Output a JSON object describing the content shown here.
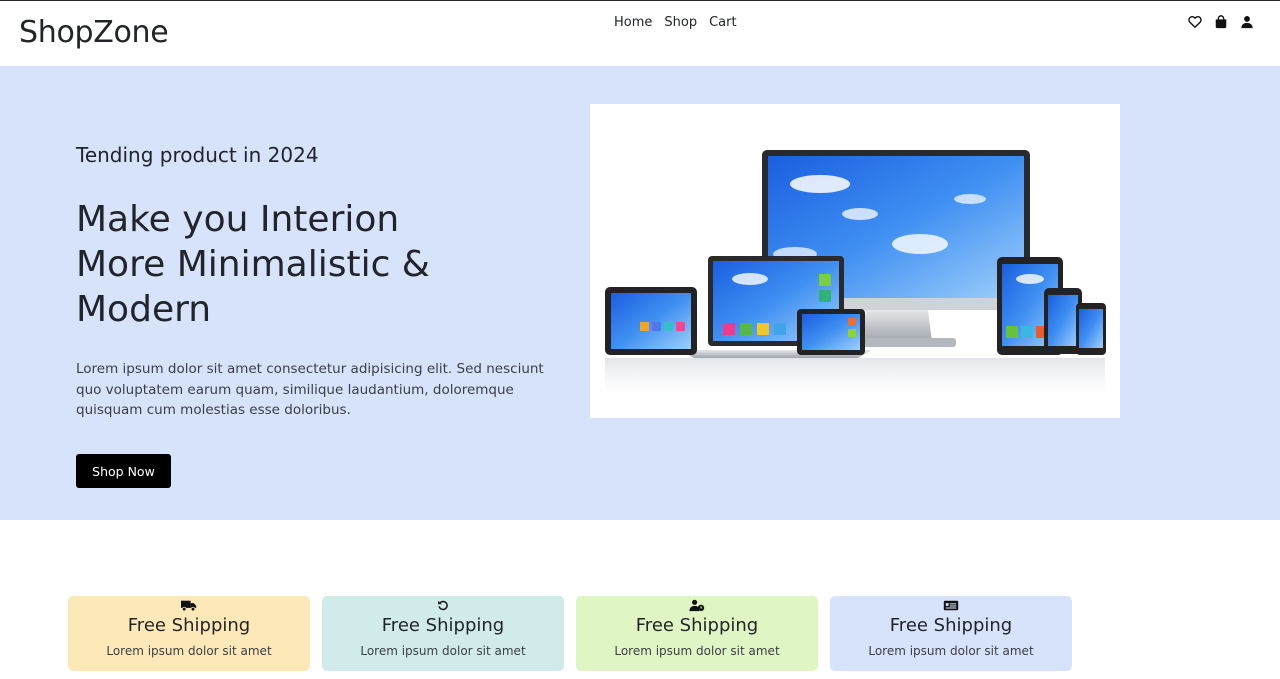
{
  "header": {
    "logo": "ShopZone",
    "nav": [
      {
        "label": "Home"
      },
      {
        "label": "Shop"
      },
      {
        "label": "Cart"
      }
    ],
    "icons": [
      "heart-icon",
      "shopping-bag-icon",
      "user-icon"
    ]
  },
  "hero": {
    "tag": "Tending product in 2024",
    "title": "Make you Interion More Minimalistic & Modern",
    "description": "Lorem ipsum dolor sit amet consectetur adipisicing elit. Sed nesciunt quo voluptatem earum quam, similique laudantium, doloremque quisquam cum molestias esse doloribus.",
    "button_label": "Shop Now",
    "background": "#d6e3fb",
    "image_alt": "devices-product-image"
  },
  "features": [
    {
      "icon": "truck-icon",
      "title": "Free Shipping",
      "text": "Lorem ipsum dolor sit amet",
      "color": "#fde9b8"
    },
    {
      "icon": "rotate-icon",
      "title": "Free Shipping",
      "text": "Lorem ipsum dolor sit amet",
      "color": "#d1ebea"
    },
    {
      "icon": "user-clock-icon",
      "title": "Free Shipping",
      "text": "Lorem ipsum dolor sit amet",
      "color": "#e0f5c4"
    },
    {
      "icon": "id-card-icon",
      "title": "Free Shipping",
      "text": "Lorem ipsum dolor sit amet",
      "color": "#d6e3fb"
    }
  ]
}
